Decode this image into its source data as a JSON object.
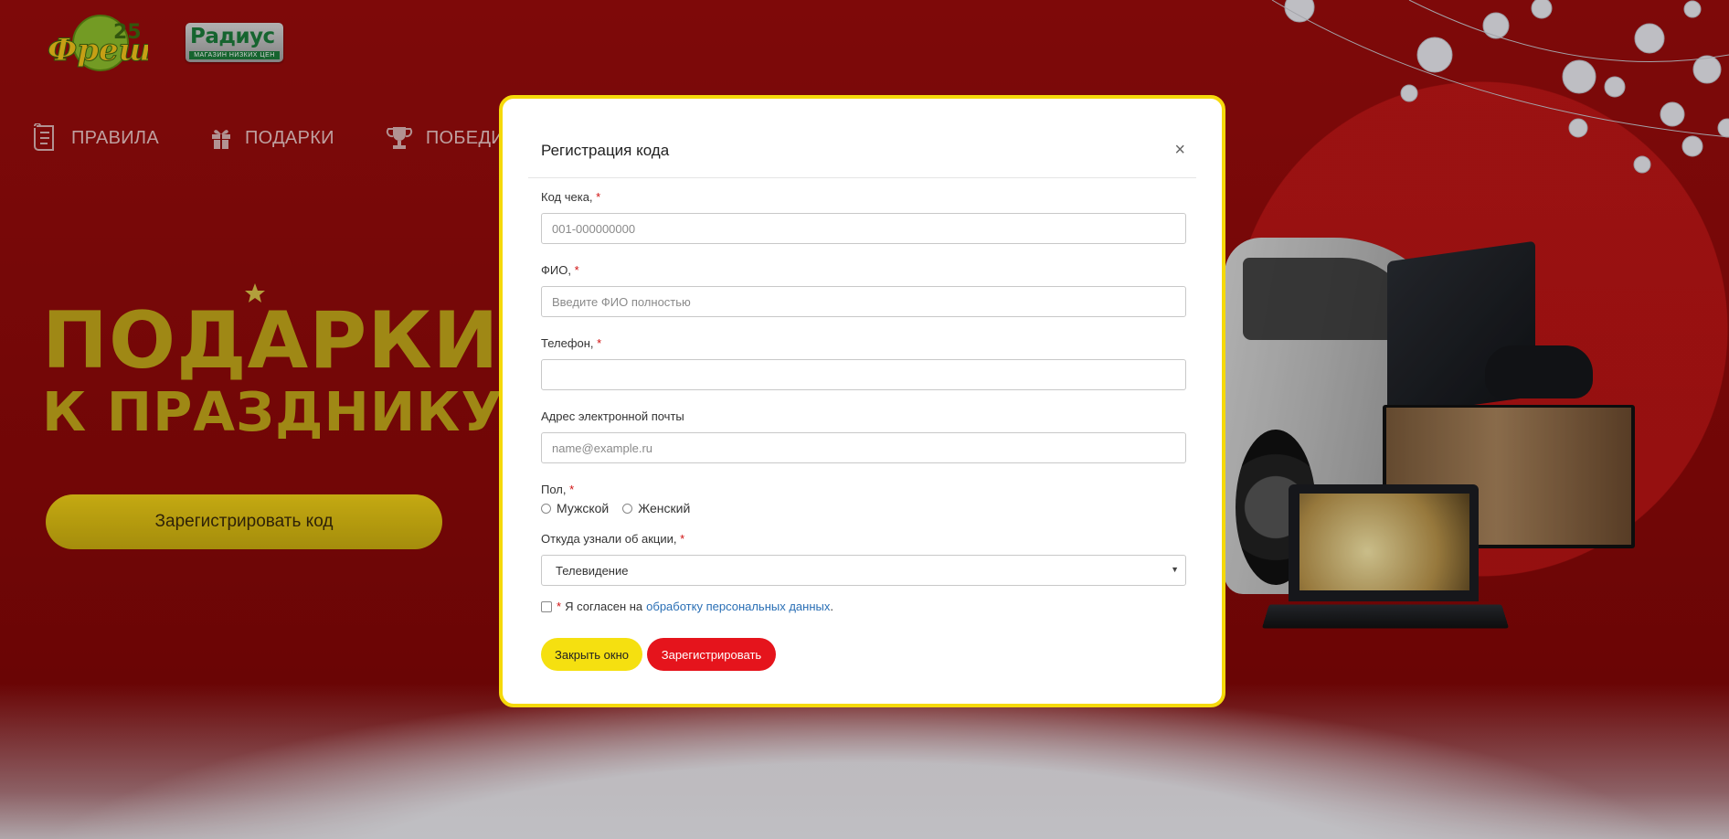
{
  "brand": {
    "fresh_logo_text": "Фреш",
    "fresh_logo_badge": "25",
    "radius_logo_text": "Радиус",
    "radius_logo_tagline": "МАГАЗИН НИЗКИХ ЦЕН"
  },
  "nav": {
    "items": [
      {
        "label": "ПРАВИЛА",
        "icon": "scroll-icon"
      },
      {
        "label": "ПОДАРКИ",
        "icon": "gift-icon"
      },
      {
        "label": "ПОБЕДИ",
        "icon": "trophy-icon"
      }
    ]
  },
  "promo": {
    "line1": "ПОДАРКИ",
    "line2": "К ПРАЗДНИКУ",
    "cta_label": "Зарегистрировать код"
  },
  "modal": {
    "title": "Регистрация кода",
    "close_symbol": "×",
    "fields": {
      "receipt_code": {
        "label": "Код чека,",
        "placeholder": "001-000000000",
        "required": "*"
      },
      "full_name": {
        "label": "ФИО,",
        "placeholder": "Введите ФИО полностью",
        "required": "*"
      },
      "phone": {
        "label": "Телефон,",
        "placeholder": "",
        "required": "*"
      },
      "email": {
        "label": "Адрес электронной почты",
        "placeholder": "name@example.ru"
      },
      "gender": {
        "label": "Пол,",
        "required": "*",
        "options": [
          "Мужской",
          "Женский"
        ]
      },
      "source": {
        "label": "Откуда узнали об акции,",
        "required": "*",
        "selected": "Телевидение"
      }
    },
    "consent": {
      "required": "*",
      "text": "Я согласен на",
      "link_text": "обработку персональных данных",
      "suffix": "."
    },
    "buttons": {
      "close": "Закрыть окно",
      "submit": "Зарегистрировать"
    }
  },
  "colors": {
    "background": "#8f0a0a",
    "modal_border": "#f5d90a",
    "accent_yellow": "#f5e010",
    "accent_red": "#e5141c",
    "promo_text": "#c3a61a",
    "link": "#2a6fb5"
  }
}
